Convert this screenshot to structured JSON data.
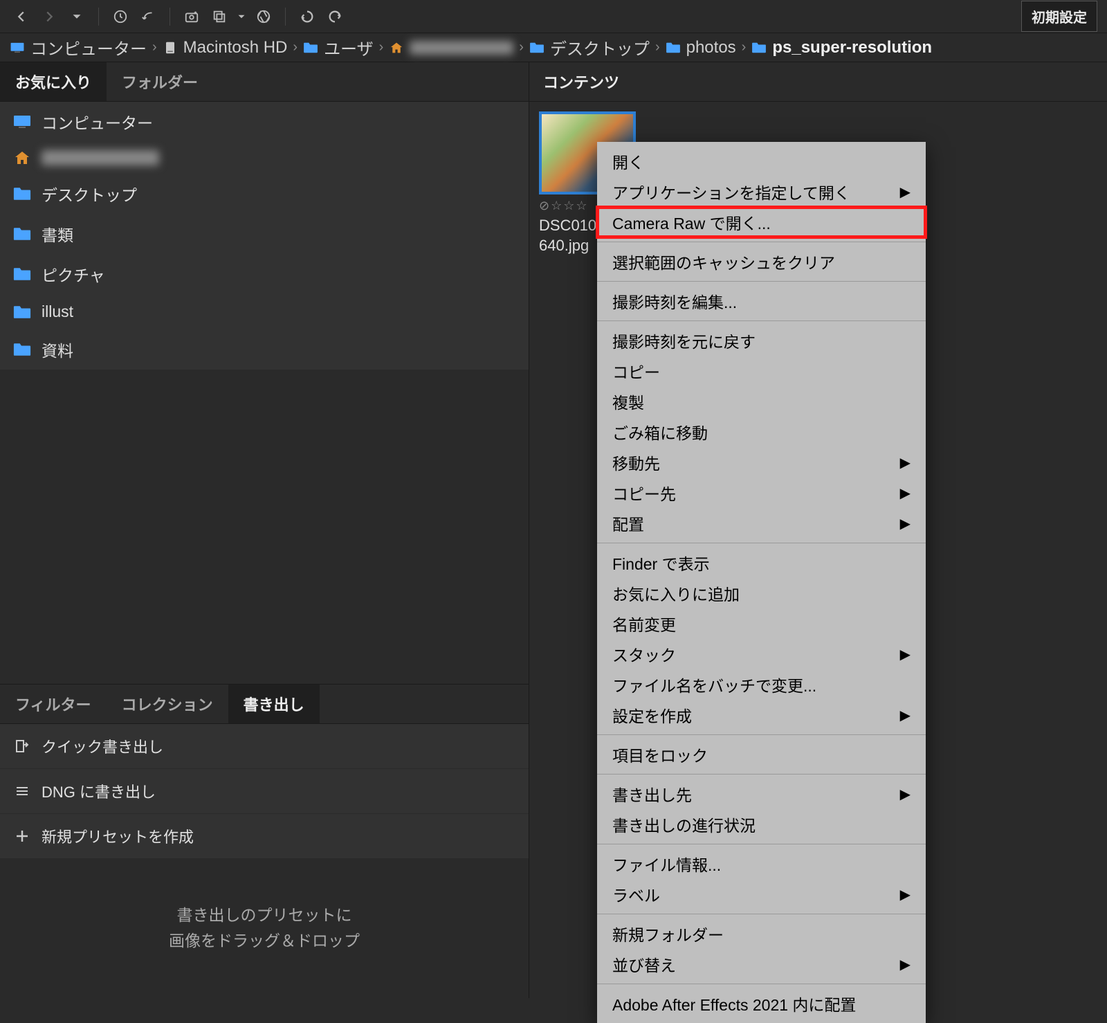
{
  "toolbar": {
    "reset_label": "初期設定"
  },
  "breadcrumb": {
    "items": [
      {
        "label": "コンピューター",
        "icon": "computer"
      },
      {
        "label": "Macintosh HD",
        "icon": "hd"
      },
      {
        "label": "ユーザ",
        "icon": "folder"
      },
      {
        "label": "",
        "icon": "home",
        "blurred": true
      },
      {
        "label": "デスクトップ",
        "icon": "folder"
      },
      {
        "label": "photos",
        "icon": "folder"
      },
      {
        "label": "ps_super-resolution",
        "icon": "folder",
        "bold": true
      }
    ]
  },
  "left_tabs": {
    "favorites": "お気に入り",
    "folders": "フォルダー"
  },
  "favorites": [
    {
      "label": "コンピューター",
      "icon": "computer"
    },
    {
      "label": "",
      "icon": "home",
      "blurred": true
    },
    {
      "label": "デスクトップ",
      "icon": "folder"
    },
    {
      "label": "書類",
      "icon": "folder"
    },
    {
      "label": "ピクチャ",
      "icon": "folder"
    },
    {
      "label": "illust",
      "icon": "folder"
    },
    {
      "label": "資料",
      "icon": "folder"
    }
  ],
  "bottom_tabs": {
    "filter": "フィルター",
    "collection": "コレクション",
    "export": "書き出し"
  },
  "export_items": {
    "quick": "クイック書き出し",
    "dng": "DNG に書き出し",
    "new_preset": "新規プリセットを作成"
  },
  "export_placeholder": {
    "line1": "書き出しのプリセットに",
    "line2": "画像をドラッグ＆ドロップ"
  },
  "content": {
    "header": "コンテンツ",
    "thumb_name_line1": "DSC010",
    "thumb_name_line2": "640.jpg"
  },
  "context_menu": {
    "groups": [
      [
        {
          "label": "開く",
          "submenu": false
        },
        {
          "label": "アプリケーションを指定して開く",
          "submenu": true
        },
        {
          "label": "Camera Raw で開く...",
          "submenu": false,
          "highlighted": true
        }
      ],
      [
        {
          "label": "選択範囲のキャッシュをクリア",
          "submenu": false
        }
      ],
      [
        {
          "label": "撮影時刻を編集...",
          "submenu": false
        }
      ],
      [
        {
          "label": "撮影時刻を元に戻す",
          "submenu": false
        },
        {
          "label": "コピー",
          "submenu": false
        },
        {
          "label": "複製",
          "submenu": false
        },
        {
          "label": "ごみ箱に移動",
          "submenu": false
        },
        {
          "label": "移動先",
          "submenu": true
        },
        {
          "label": "コピー先",
          "submenu": true
        },
        {
          "label": "配置",
          "submenu": true
        }
      ],
      [
        {
          "label": "Finder で表示",
          "submenu": false
        },
        {
          "label": "お気に入りに追加",
          "submenu": false
        },
        {
          "label": "名前変更",
          "submenu": false
        },
        {
          "label": "スタック",
          "submenu": true
        },
        {
          "label": "ファイル名をバッチで変更...",
          "submenu": false
        },
        {
          "label": "設定を作成",
          "submenu": true
        }
      ],
      [
        {
          "label": "項目をロック",
          "submenu": false
        }
      ],
      [
        {
          "label": "書き出し先",
          "submenu": true
        },
        {
          "label": "書き出しの進行状況",
          "submenu": false
        }
      ],
      [
        {
          "label": "ファイル情報...",
          "submenu": false
        },
        {
          "label": "ラベル",
          "submenu": true
        }
      ],
      [
        {
          "label": "新規フォルダー",
          "submenu": false
        },
        {
          "label": "並び替え",
          "submenu": true
        }
      ],
      [
        {
          "label": "Adobe After Effects 2021 内に配置",
          "submenu": false
        }
      ]
    ]
  }
}
